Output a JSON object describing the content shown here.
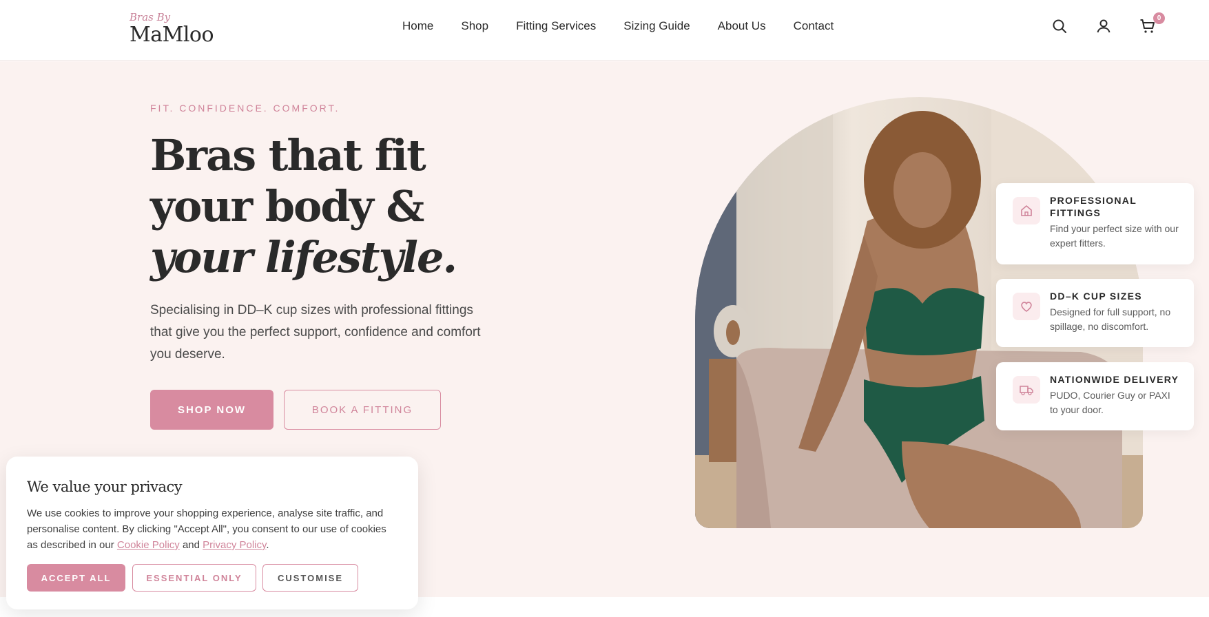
{
  "brand": {
    "prefix": "Bras By",
    "name": "MaMloo"
  },
  "nav": [
    "Home",
    "Shop",
    "Fitting Services",
    "Sizing Guide",
    "About Us",
    "Contact"
  ],
  "header_icons": {
    "search": "search-icon",
    "account": "user-icon",
    "cart": "cart-icon",
    "cart_count": "0"
  },
  "hero": {
    "eyebrow": "FIT. CONFIDENCE. COMFORT.",
    "headline_part1": "Bras that fit your body & ",
    "headline_italic": "your lifestyle.",
    "description": "Specialising in DD–K cup sizes with professional fittings that give you the perfect support, confidence and comfort you deserve.",
    "primary_button": "SHOP NOW",
    "secondary_button": "BOOK A FITTING"
  },
  "features": [
    {
      "icon": "home-icon",
      "title": "PROFESSIONAL FITTINGS",
      "desc": "Find your perfect size with our expert fitters."
    },
    {
      "icon": "heart-icon",
      "title": "DD–K CUP SIZES",
      "desc": "Designed for full support, no spillage, no discomfort."
    },
    {
      "icon": "truck-icon",
      "title": "NATIONWIDE DELIVERY",
      "desc": "PUDO, Courier Guy or PAXI to your door."
    }
  ],
  "cookie": {
    "title": "We value your privacy",
    "text_before": "We use cookies to improve your shopping experience, analyse site traffic, and personalise content. By clicking \"Accept All\", you consent to our use of cookies as described in our ",
    "cookie_policy": "Cookie Policy",
    "and": " and ",
    "privacy_policy": "Privacy Policy",
    "end": ".",
    "accept": "ACCEPT ALL",
    "essential": "ESSENTIAL ONLY",
    "customise": "CUSTOMISE"
  },
  "colors": {
    "accent": "#d88ba0",
    "hero_bg": "#fbf2f0",
    "text": "#2a2a2a"
  }
}
